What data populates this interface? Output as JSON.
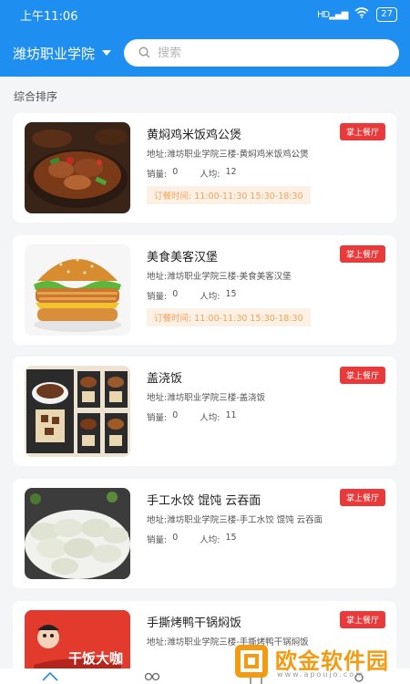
{
  "status_bar": {
    "time": "上午11:06",
    "signal": "HD",
    "battery": "27"
  },
  "header": {
    "school_name": "潍坊职业学院",
    "search_placeholder": "搜索"
  },
  "section_title": "综合排序",
  "labels": {
    "address": "地址:",
    "sales": "销量:",
    "avg": "人均:",
    "order_time": "订餐时间:"
  },
  "restaurants": [
    {
      "name": "黄焖鸡米饭鸡公煲",
      "badge": "掌上餐厅",
      "address": "潍坊职业学院三楼-黄焖鸡米饭鸡公煲",
      "sales": "0",
      "avg": "12",
      "hours": "11:00-11:30    15:30-18:30",
      "image_icon": "braised-chicken-image"
    },
    {
      "name": "美食美客汉堡",
      "badge": "掌上餐厅",
      "address": "潍坊职业学院三楼-美食美客汉堡",
      "sales": "0",
      "avg": "15",
      "hours": "11:00-11:30    15:30-18:30",
      "image_icon": "burger-image"
    },
    {
      "name": "盖浇饭",
      "badge": "掌上餐厅",
      "address": "潍坊职业学院三楼-盖浇饭",
      "sales": "0",
      "avg": "11",
      "image_icon": "rice-bowl-poster-image"
    },
    {
      "name": "手工水饺 馄饨 云吞面",
      "badge": "掌上餐厅",
      "address": "潍坊职业学院三楼-手工水饺 馄饨 云吞面",
      "sales": "0",
      "avg": "15",
      "image_icon": "dumplings-image"
    },
    {
      "name": "手撕烤鸭干锅焖饭",
      "badge": "掌上餐厅",
      "address": "潍坊职业学院三楼-手撕烤鸭干锅焖饭",
      "image_icon": "roast-duck-image",
      "image_text": "干饭大咖"
    }
  ],
  "watermark": {
    "text": "欧金软件园",
    "url": "www.apoujo.com"
  },
  "colors": {
    "primary": "#1f8ef1",
    "badge": "#e83a3a",
    "hours_bg": "#fdf1e6",
    "hours_text": "#f3a25c"
  }
}
